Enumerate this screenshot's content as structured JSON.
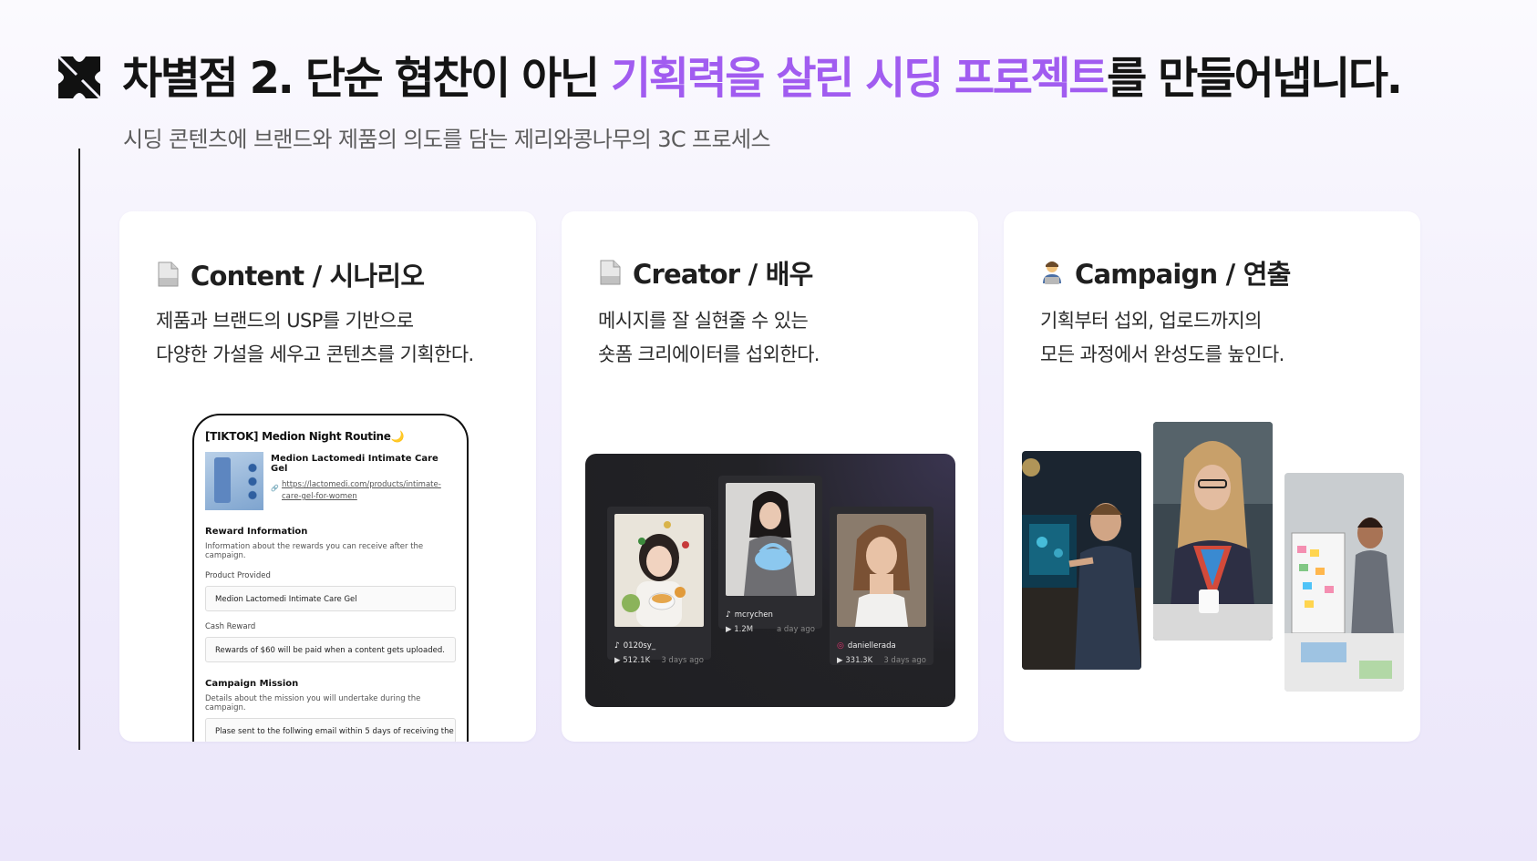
{
  "header": {
    "logo_icon": "jellyboo-logo-icon",
    "title_prefix": "차별점 2. 단순 협찬이 아닌 ",
    "title_highlight": "기획력을 살린 시딩 프로젝트",
    "title_suffix": "를 만들어냅니다.",
    "subtitle": "시딩 콘텐츠에 브랜드와 제품의 의도를 담는 제리와콩나무의 3C 프로세스",
    "highlight_color": "#a15cf0"
  },
  "cards": [
    {
      "icon": "page-icon",
      "title": "Content / 시나리오",
      "desc_line1": "제품과 브랜드의 USP를 기반으로",
      "desc_line2": "다양한 가설을 세우고 콘텐츠를 기획한다."
    },
    {
      "icon": "page-icon",
      "title": "Creator / 배우",
      "desc_line1": "메시지를 잘 실현줄 수 있는",
      "desc_line2": "숏폼 크리에이터를 섭외한다."
    },
    {
      "icon": "technologist-icon",
      "title": "Campaign / 연출",
      "desc_line1": "기획부터 섭외, 업로드까지의",
      "desc_line2": "모든 과정에서 완성도를 높인다."
    }
  ],
  "phone": {
    "title": "[TIKTOK] Medion Night Routine🌙",
    "product_name": "Medion Lactomedi Intimate Care Gel",
    "product_link": "https://lactomedi.com/products/intimate-care-gel-for-women",
    "reward_heading": "Reward Information",
    "reward_sub": "Information about the rewards you can receive after the campaign.",
    "product_label": "Product Provided",
    "product_value": "Medion Lactomedi Intimate Care Gel",
    "cash_label": "Cash Reward",
    "cash_value": "Rewards of $60 will be paid when a content gets uploaded.",
    "mission_heading": "Campaign Mission",
    "mission_sub": "Details about the mission you will undertake during the campaign.",
    "mission_value": "Plase sent to the follwing email within 5 days of receiving the"
  },
  "creators": [
    {
      "name": "0120sy_",
      "views": "512.1K",
      "ago": "3 days ago",
      "platform": "tiktok"
    },
    {
      "name": "mcrychen",
      "views": "1.2M",
      "ago": "a day ago",
      "platform": "tiktok"
    },
    {
      "name": "daniellerada",
      "views": "331.3K",
      "ago": "3 days ago",
      "platform": "instagram"
    }
  ]
}
